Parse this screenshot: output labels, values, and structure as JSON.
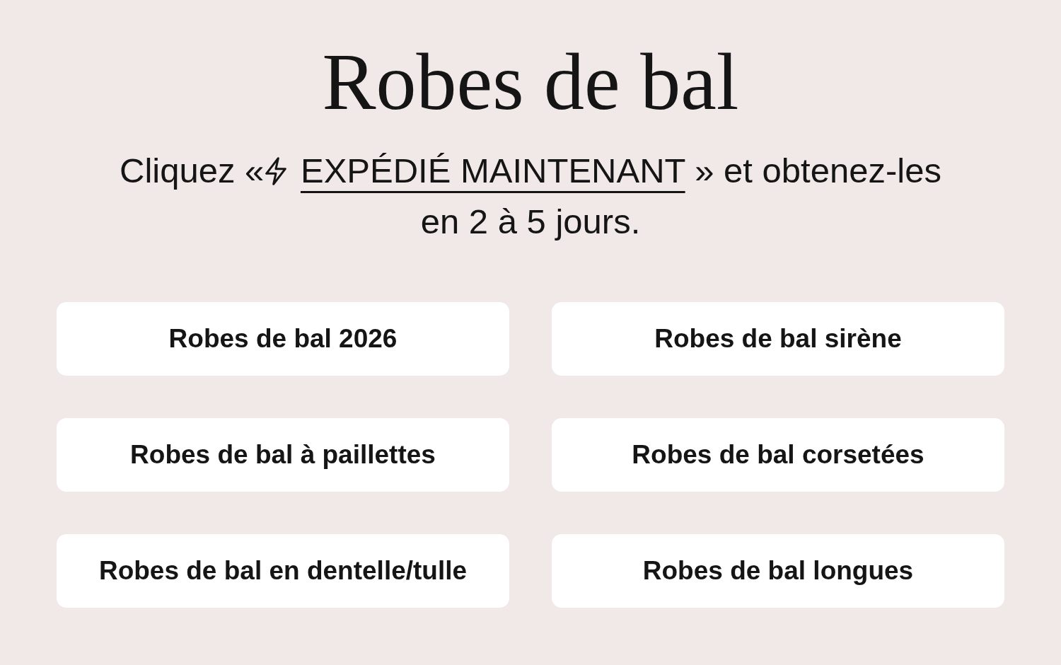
{
  "title": "Robes de bal",
  "subtitle": {
    "before": "Cliquez «",
    "link": "EXPÉDIÉ MAINTENANT",
    "after": " » et obtenez-les en 2 à 5 jours."
  },
  "categories": [
    "Robes de bal 2026",
    "Robes de bal sirène",
    "Robes de bal à paillettes",
    "Robes de bal corsetées",
    "Robes de bal en dentelle/tulle",
    "Robes de bal longues"
  ]
}
